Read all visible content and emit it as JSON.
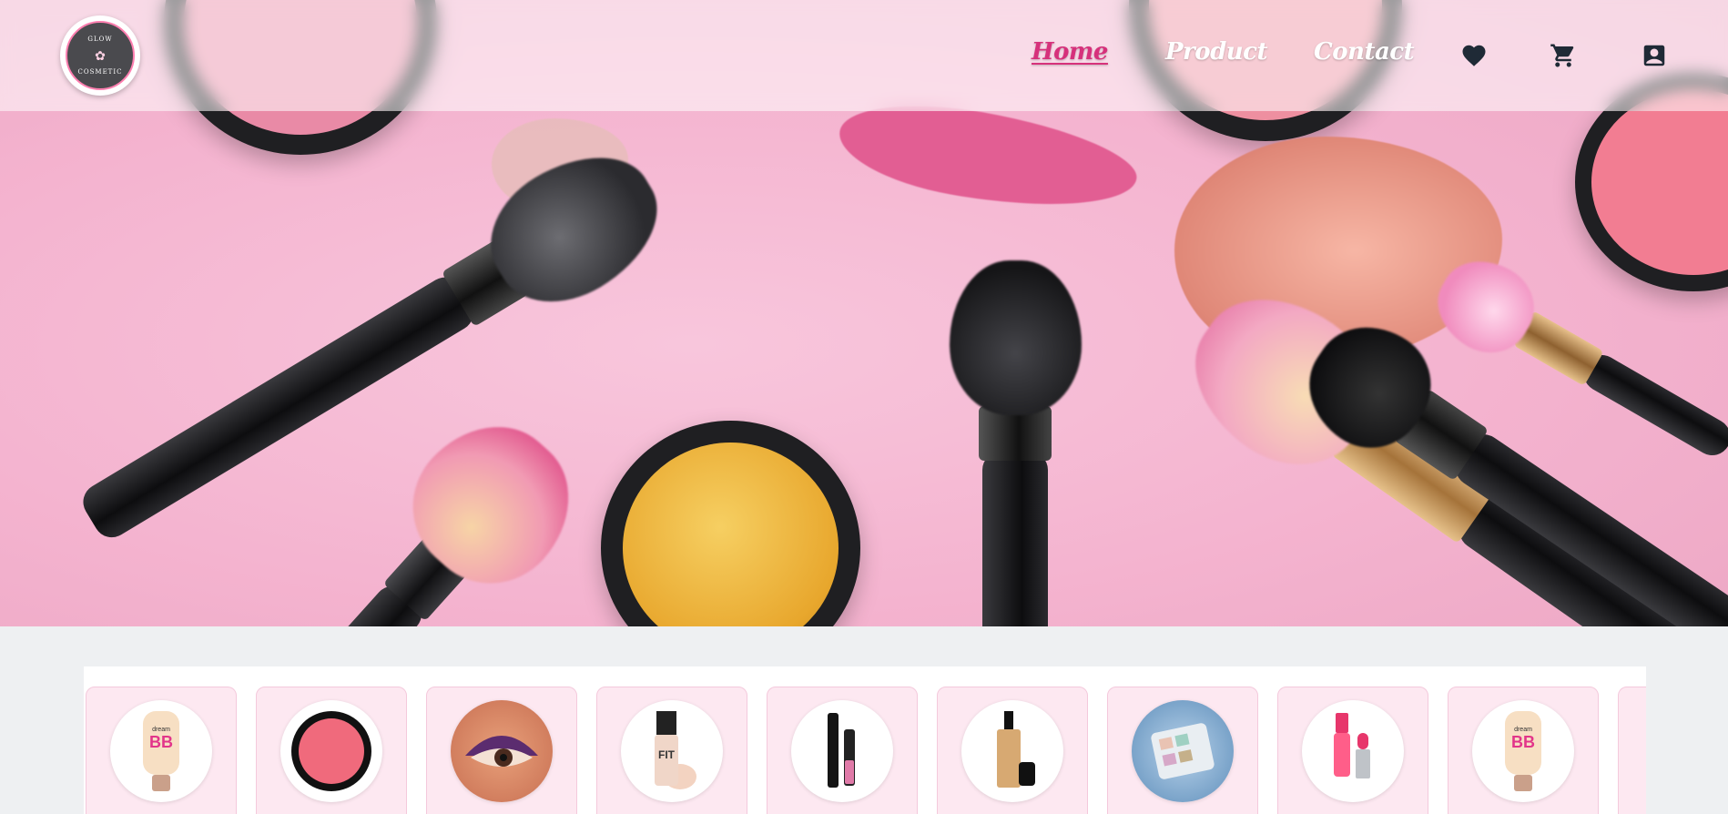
{
  "brand": {
    "logo_top": "GLOW",
    "logo_bottom": "COSMETIC",
    "logo_mark": "✿"
  },
  "nav": {
    "links": [
      {
        "label": "Home",
        "active": true
      },
      {
        "label": "Product",
        "active": false
      },
      {
        "label": "Contact",
        "active": false
      }
    ],
    "icons": [
      "heart-icon",
      "cart-icon",
      "account-icon"
    ]
  },
  "colors": {
    "accent": "#d6317b",
    "card_bg": "#fde8f1",
    "hero_bg": "#f4b3cf"
  },
  "products": [
    {
      "name": "bb-cream",
      "image": "bb-cream-icon"
    },
    {
      "name": "blush-compact",
      "image": "blush-compact-icon"
    },
    {
      "name": "eyeshadow-look",
      "image": "eye-makeup-icon"
    },
    {
      "name": "foundation-fit-me",
      "image": "foundation-icon"
    },
    {
      "name": "mascara-liner",
      "image": "mascara-icon"
    },
    {
      "name": "liquid-foundation",
      "image": "foundation-bottle-icon"
    },
    {
      "name": "eyeshadow-palette",
      "image": "palette-icon"
    },
    {
      "name": "lip-gloss",
      "image": "lip-gloss-icon"
    },
    {
      "name": "bb-cream-2",
      "image": "bb-cream-icon"
    },
    {
      "name": "partial-card",
      "image": "product-icon"
    }
  ]
}
